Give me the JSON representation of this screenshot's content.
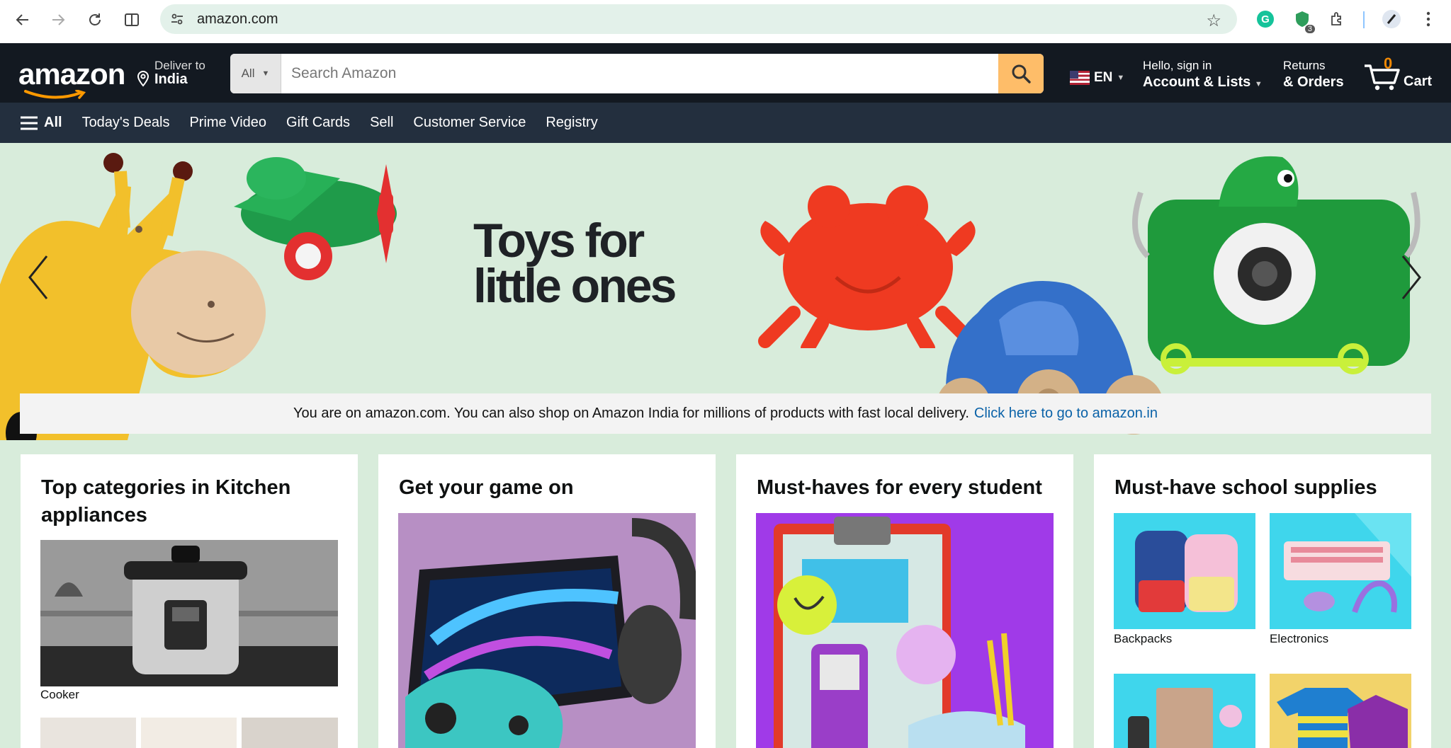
{
  "browser": {
    "url": "amazon.com",
    "extension_badge": "3"
  },
  "header": {
    "logo_text": "amazon",
    "deliver": {
      "line1": "Deliver to",
      "line2": "India"
    },
    "search": {
      "category": "All",
      "placeholder": "Search Amazon"
    },
    "language": "EN",
    "account": {
      "line1": "Hello, sign in",
      "line2": "Account & Lists"
    },
    "returns": {
      "line1": "Returns",
      "line2": "& Orders"
    },
    "cart": {
      "count": "0",
      "label": "Cart"
    }
  },
  "subnav": {
    "all_label": "All",
    "items": [
      "Today's Deals",
      "Prime Video",
      "Gift Cards",
      "Sell",
      "Customer Service",
      "Registry"
    ]
  },
  "hero": {
    "title_line1": "Toys for",
    "title_line2": "little ones"
  },
  "notice": {
    "text": "You are on amazon.com. You can also shop on Amazon India for millions of products with fast local delivery.",
    "link": "Click here to go to amazon.in"
  },
  "cards": [
    {
      "title": "Top categories in Kitchen appliances",
      "tiles": [
        "Cooker"
      ]
    },
    {
      "title": "Get your game on"
    },
    {
      "title": "Must-haves for every student"
    },
    {
      "title": "Must-have school supplies",
      "tiles": [
        "Backpacks",
        "Electronics"
      ]
    }
  ],
  "colors": {
    "nav_main": "#131921",
    "nav_sub": "#232f3e",
    "search_button": "#febd69",
    "cart_count": "#f08804",
    "link": "#0a62a8",
    "hero_bg": "#d8ecdb"
  }
}
